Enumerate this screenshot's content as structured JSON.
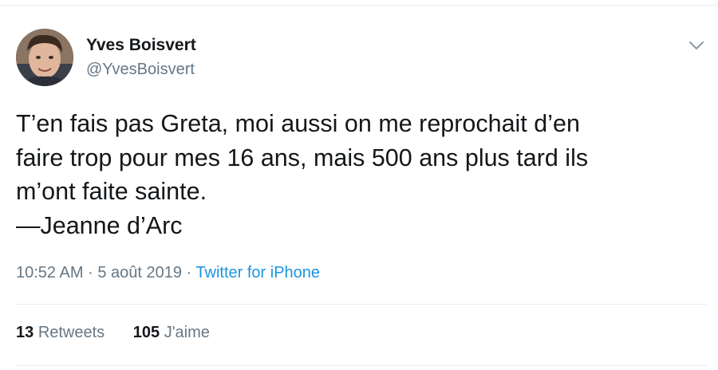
{
  "author": {
    "name": "Yves Boisvert",
    "handle": "@YvesBoisvert"
  },
  "tweet": {
    "lines": [
      "T’en fais pas Greta, moi aussi on me reprochait d’en",
      "faire trop pour mes 16 ans, mais 500 ans plus tard ils",
      "m’ont faite sainte.",
      "—Jeanne d’Arc"
    ]
  },
  "meta": {
    "time": "10:52 AM",
    "separator": "·",
    "date": "5 août 2019",
    "source": "Twitter for iPhone"
  },
  "stats": {
    "retweets_count": "13",
    "retweets_label": "Retweets",
    "likes_count": "105",
    "likes_label": "J'aime"
  },
  "icons": {
    "menu_caret": "chevron-down-icon"
  },
  "colors": {
    "text": "#14171a",
    "secondary": "#657786",
    "link": "#1b95e0",
    "border": "#e6ecf0"
  }
}
